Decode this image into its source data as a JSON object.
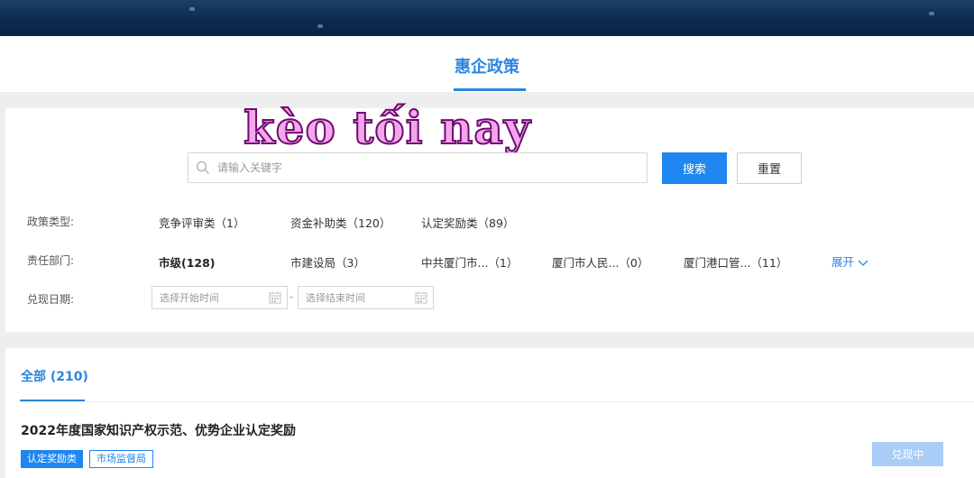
{
  "header": {
    "tab_title": "惠企政策"
  },
  "overlay": {
    "watermark_text": "kèo tối nay"
  },
  "search": {
    "placeholder": "请输入关键字",
    "search_label": "搜索",
    "reset_label": "重置"
  },
  "filters": {
    "policy_type": {
      "label": "政策类型:",
      "options": [
        "竞争评审类（1）",
        "资金补助类（120）",
        "认定奖励类（89）"
      ]
    },
    "department": {
      "label": "责任部门:",
      "options": [
        "市级(128)",
        "市建设局（3）",
        "中共厦门市...（1）",
        "厦门市人民...（0）",
        "厦门港口管...（11）"
      ],
      "expand_label": "展开"
    },
    "date": {
      "label": "兑现日期:",
      "start_placeholder": "选择开始时间",
      "end_placeholder": "选择结束时间",
      "separator": "-"
    }
  },
  "results": {
    "tab_label": "全部 (210)",
    "items": [
      {
        "title": "2022年度国家知识产权示范、优势企业认定奖励",
        "tags": [
          "认定奖励类",
          "市场监督局"
        ],
        "status": "兑现中"
      }
    ]
  },
  "colors": {
    "accent": "#2b86e0",
    "primary_button": "#1e87f0",
    "status_button": "#a9cdf6",
    "watermark_fill": "#f4a6ea",
    "watermark_stroke": "#6e0a72"
  }
}
